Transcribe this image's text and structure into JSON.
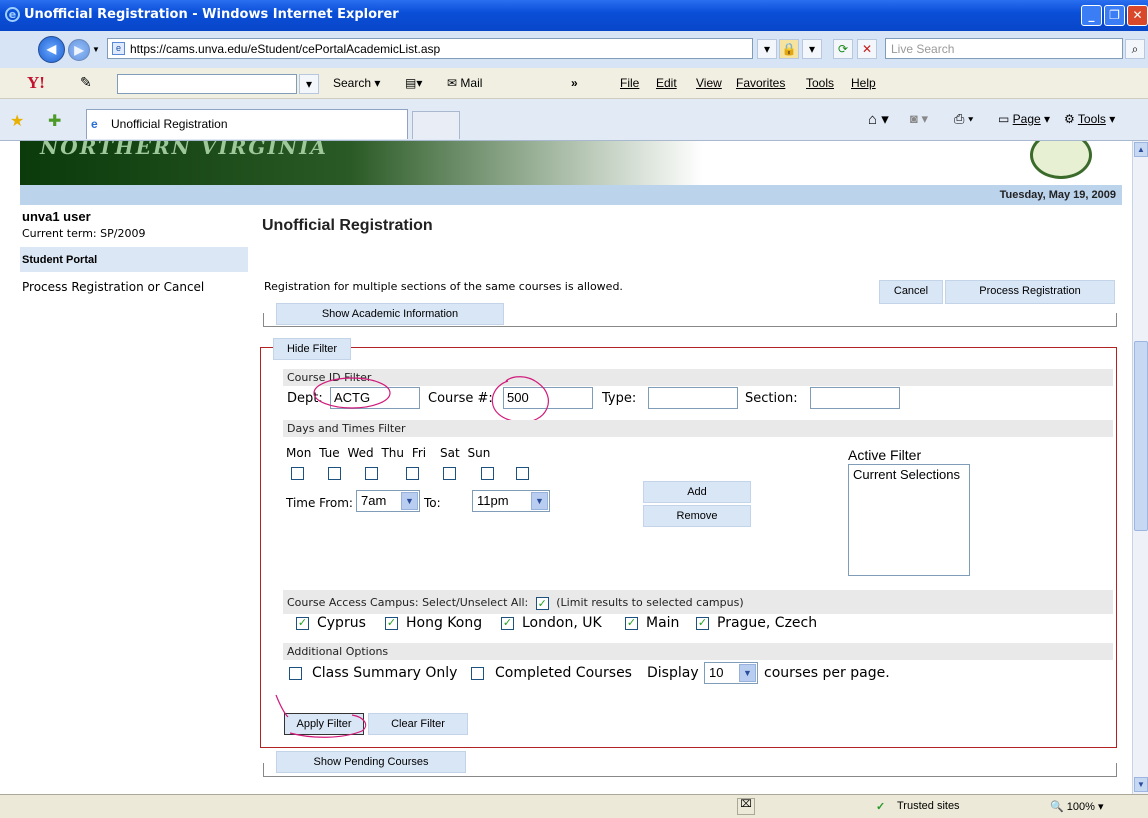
{
  "window": {
    "title": "Unofficial Registration - Windows Internet Explorer"
  },
  "nav": {
    "url": "https://cams.unva.edu/eStudent/cePortalAcademicList.asp",
    "search_placeholder": "Live Search"
  },
  "toolbar": {
    "search": "Search",
    "mail": "Mail",
    "chevrons": "»",
    "menus": [
      "File",
      "Edit",
      "View",
      "Favorites",
      "Tools",
      "Help"
    ]
  },
  "tabs": {
    "active": "Unofficial Registration"
  },
  "cmdbar": {
    "page": "Page",
    "tools": "Tools"
  },
  "page": {
    "date": "Tuesday, May 19, 2009",
    "user": "unva1 user",
    "term": "Current term: SP/2009",
    "portal": "Student Portal",
    "process_link": "Process Registration or Cancel",
    "title": "Unofficial Registration",
    "multi_note": "Registration for multiple sections of the same courses is allowed.",
    "cancel": "Cancel",
    "process": "Process Registration",
    "show_academic": "Show Academic Information",
    "hide_filter": "Hide Filter",
    "course_id_filter": "Course ID Filter",
    "dept_label": "Dept:",
    "dept_value": "ACTG",
    "course_label": "Course #:",
    "course_value": "500",
    "type_label": "Type:",
    "section_label": "Section:",
    "days_filter": "Days and Times Filter",
    "days": [
      "Mon",
      "Tue",
      "Wed",
      "Thu",
      "Fri",
      "Sat",
      "Sun"
    ],
    "time_from_label": "Time From:",
    "time_from": "7am",
    "to_label": "To:",
    "time_to": "11pm",
    "add": "Add",
    "remove": "Remove",
    "active_filter": "Active Filter",
    "current_selections": "Current Selections",
    "campus_label": "Course Access Campus: Select/Unselect All:",
    "campus_limit": "(Limit results to selected campus)",
    "campuses": [
      "Cyprus",
      "Hong Kong",
      "London, UK",
      "Main",
      "Prague, Czech"
    ],
    "additional": "Additional Options",
    "class_summary": "Class Summary Only",
    "completed": "Completed Courses",
    "display": "Display",
    "per_page_value": "10",
    "per_page_suffix": "courses per page.",
    "apply": "Apply Filter",
    "clear": "Clear Filter",
    "show_pending": "Show Pending Courses",
    "banner_logo": "NORTHERN VIRGINIA"
  },
  "status": {
    "zone": "Trusted sites",
    "zoom": "100%"
  }
}
